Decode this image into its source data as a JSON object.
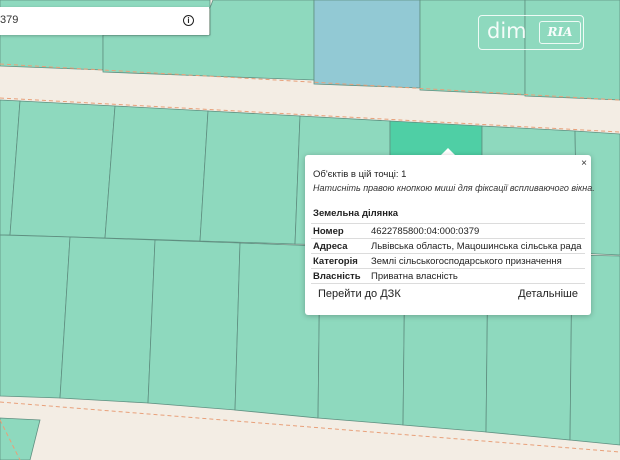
{
  "search": {
    "value": "379"
  },
  "watermark": {
    "brand_left": "dim",
    "brand_right": "RIA"
  },
  "popup": {
    "objects_count_text": "Об'єктів в цій точці: 1",
    "hint_text": "Натисніть правою кнопкою миші для фіксації вспливаючого вікна.",
    "section_title": "Земельна ділянка",
    "rows": [
      {
        "label": "Номер",
        "value": "4622785800:04:000:0379"
      },
      {
        "label": "Адреса",
        "value": "Львівська область, Мацошинська сільська рада"
      },
      {
        "label": "Категорія",
        "value": "Землі сільськогосподарського призначення"
      },
      {
        "label": "Власність",
        "value": "Приватна власність"
      }
    ],
    "close_label": "×",
    "dzk_button_label": "Перейти до ДЗК",
    "details_button_label": "Детальніше"
  },
  "colors": {
    "parcel": "#8ed9be",
    "parcel_selected": "#4fcfa5",
    "parcel_blue": "#92c9d4",
    "road": "#f3ede4",
    "parcel_border": "#5f8f80",
    "boundary_dashed": "#e8a07a"
  },
  "icons": {
    "info": "info-circle-icon",
    "close": "close-icon"
  }
}
